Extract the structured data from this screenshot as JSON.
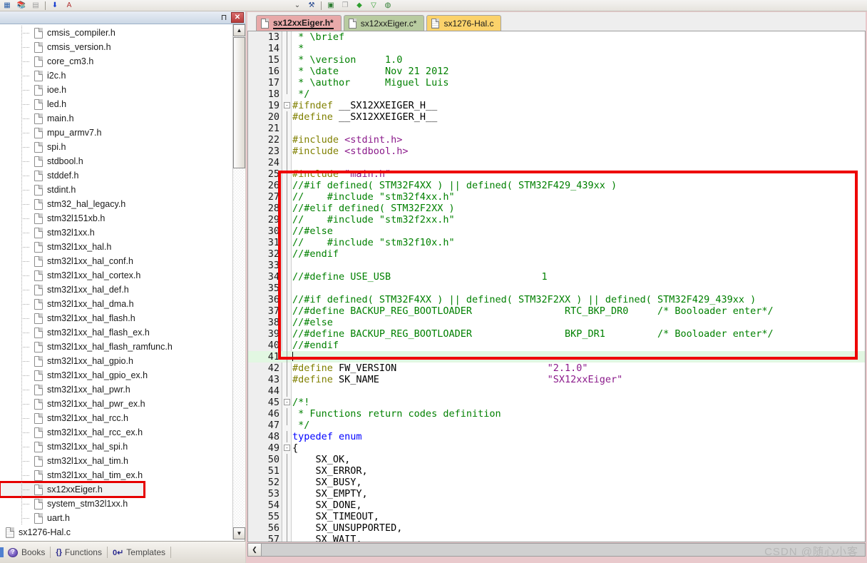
{
  "toolbar": {
    "icons": [
      {
        "name": "grid-icon",
        "glyph": "▦",
        "color": "#2b5fa8"
      },
      {
        "name": "books-stack-icon",
        "glyph": "📚",
        "color": "#2e7d32"
      },
      {
        "name": "remove-book-icon",
        "glyph": "▤",
        "color": "#9e9e9e"
      },
      {
        "name": "sep",
        "glyph": "",
        "color": ""
      },
      {
        "name": "download-arrow-icon",
        "glyph": "⬇",
        "color": "#1a3fd0"
      },
      {
        "name": "font-a-icon",
        "glyph": "A",
        "color": "#b03030"
      },
      {
        "name": "gap",
        "glyph": "",
        "color": ""
      },
      {
        "name": "chevron-down-icon",
        "glyph": "⌄",
        "color": "#444444"
      },
      {
        "name": "binoculars-icon",
        "glyph": "⚒",
        "color": "#1b3f8b"
      },
      {
        "name": "sep",
        "glyph": "",
        "color": ""
      },
      {
        "name": "window-split-icon",
        "glyph": "▣",
        "color": "#2e7d32"
      },
      {
        "name": "window-cascade-icon",
        "glyph": "❐",
        "color": "#9e9e9e"
      },
      {
        "name": "gem-green-icon",
        "glyph": "◆",
        "color": "#2e9e2e"
      },
      {
        "name": "filter-icon",
        "glyph": "▽",
        "color": "#2e9e2e"
      },
      {
        "name": "globe-icon",
        "glyph": "◍",
        "color": "#2e7d32"
      }
    ]
  },
  "project_panel": {
    "pin_label": "⊓",
    "close_label": "✕",
    "tree": [
      {
        "label": "cmsis_compiler.h",
        "type": "header"
      },
      {
        "label": "cmsis_version.h",
        "type": "header"
      },
      {
        "label": "core_cm3.h",
        "type": "header"
      },
      {
        "label": "i2c.h",
        "type": "header"
      },
      {
        "label": "ioe.h",
        "type": "header"
      },
      {
        "label": "led.h",
        "type": "header"
      },
      {
        "label": "main.h",
        "type": "header"
      },
      {
        "label": "mpu_armv7.h",
        "type": "header"
      },
      {
        "label": "spi.h",
        "type": "header"
      },
      {
        "label": "stdbool.h",
        "type": "header"
      },
      {
        "label": "stddef.h",
        "type": "header"
      },
      {
        "label": "stdint.h",
        "type": "header"
      },
      {
        "label": "stm32_hal_legacy.h",
        "type": "header"
      },
      {
        "label": "stm32l151xb.h",
        "type": "header"
      },
      {
        "label": "stm32l1xx.h",
        "type": "header"
      },
      {
        "label": "stm32l1xx_hal.h",
        "type": "header"
      },
      {
        "label": "stm32l1xx_hal_conf.h",
        "type": "header"
      },
      {
        "label": "stm32l1xx_hal_cortex.h",
        "type": "header"
      },
      {
        "label": "stm32l1xx_hal_def.h",
        "type": "header"
      },
      {
        "label": "stm32l1xx_hal_dma.h",
        "type": "header"
      },
      {
        "label": "stm32l1xx_hal_flash.h",
        "type": "header"
      },
      {
        "label": "stm32l1xx_hal_flash_ex.h",
        "type": "header"
      },
      {
        "label": "stm32l1xx_hal_flash_ramfunc.h",
        "type": "header"
      },
      {
        "label": "stm32l1xx_hal_gpio.h",
        "type": "header"
      },
      {
        "label": "stm32l1xx_hal_gpio_ex.h",
        "type": "header"
      },
      {
        "label": "stm32l1xx_hal_pwr.h",
        "type": "header"
      },
      {
        "label": "stm32l1xx_hal_pwr_ex.h",
        "type": "header"
      },
      {
        "label": "stm32l1xx_hal_rcc.h",
        "type": "header"
      },
      {
        "label": "stm32l1xx_hal_rcc_ex.h",
        "type": "header"
      },
      {
        "label": "stm32l1xx_hal_spi.h",
        "type": "header"
      },
      {
        "label": "stm32l1xx_hal_tim.h",
        "type": "header"
      },
      {
        "label": "stm32l1xx_hal_tim_ex.h",
        "type": "header"
      },
      {
        "label": "sx12xxEiger.h",
        "type": "header",
        "selected": true,
        "highlight_box": true
      },
      {
        "label": "system_stm32l1xx.h",
        "type": "header"
      },
      {
        "label": "uart.h",
        "type": "header"
      },
      {
        "label": "sx1276-Hal.c",
        "type": "source",
        "root": true,
        "expander": "+"
      }
    ],
    "scroll_up_glyph": "▲",
    "scroll_down_glyph": "▼"
  },
  "bottom_tabs": [
    {
      "label": "Books",
      "icon": "books-icon"
    },
    {
      "label": "Functions",
      "icon": "braces-icon",
      "glyph": "{}"
    },
    {
      "label": "Templates",
      "icon": "template-icon",
      "glyph": "0↵"
    }
  ],
  "editor_tabs": [
    {
      "label": "sx12xxEiger.h*",
      "active": true,
      "bg": "#e8a9a9",
      "icon": "file-icon"
    },
    {
      "label": "sx12xxEiger.c*",
      "active": false,
      "bg": "#b8cba0",
      "icon": "file-icon"
    },
    {
      "label": "sx1276-Hal.c",
      "active": false,
      "bg": "#fbd26b",
      "icon": "file-c-icon"
    }
  ],
  "editor": {
    "first_line": 13,
    "current_line": 41,
    "hscroll_left_glyph": "❮",
    "lines": [
      {
        "n": 13,
        "fold": "",
        "rule": "full",
        "tokens": [
          {
            "t": " * \\brief",
            "c": "cmt"
          }
        ]
      },
      {
        "n": 14,
        "fold": "",
        "rule": "full",
        "tokens": [
          {
            "t": " *",
            "c": "cmt"
          }
        ]
      },
      {
        "n": 15,
        "fold": "",
        "rule": "full",
        "tokens": [
          {
            "t": " * \\version     1.0",
            "c": "cmt"
          }
        ]
      },
      {
        "n": 16,
        "fold": "",
        "rule": "full",
        "tokens": [
          {
            "t": " * \\date        Nov 21 2012",
            "c": "cmt"
          }
        ]
      },
      {
        "n": 17,
        "fold": "",
        "rule": "full",
        "tokens": [
          {
            "t": " * \\author      Miguel Luis",
            "c": "cmt"
          }
        ]
      },
      {
        "n": 18,
        "fold": "",
        "rule": "end",
        "tokens": [
          {
            "t": " */",
            "c": "cmt"
          }
        ]
      },
      {
        "n": 19,
        "fold": "-",
        "rule": "none",
        "tokens": [
          {
            "t": "#ifndef",
            "c": "pp"
          },
          {
            "t": " __SX12XXEIGER_H__",
            "c": "id"
          }
        ]
      },
      {
        "n": 20,
        "fold": "",
        "rule": "full",
        "tokens": [
          {
            "t": "#define",
            "c": "pp"
          },
          {
            "t": " __SX12XXEIGER_H__",
            "c": "id"
          }
        ]
      },
      {
        "n": 21,
        "fold": "",
        "rule": "full",
        "tokens": []
      },
      {
        "n": 22,
        "fold": "",
        "rule": "full",
        "tokens": [
          {
            "t": "#include",
            "c": "pp"
          },
          {
            "t": " <stdint.h>",
            "c": "str"
          }
        ]
      },
      {
        "n": 23,
        "fold": "",
        "rule": "full",
        "tokens": [
          {
            "t": "#include",
            "c": "pp"
          },
          {
            "t": " <stdbool.h>",
            "c": "str"
          }
        ]
      },
      {
        "n": 24,
        "fold": "",
        "rule": "full",
        "tokens": []
      },
      {
        "n": 25,
        "fold": "",
        "rule": "full",
        "tokens": [
          {
            "t": "#include",
            "c": "pp"
          },
          {
            "t": " \"main.h\"",
            "c": "str"
          }
        ]
      },
      {
        "n": 26,
        "fold": "",
        "rule": "full",
        "tokens": [
          {
            "t": "//#if defined( STM32F4XX ) || defined( STM32F429_439xx )",
            "c": "cmt"
          }
        ]
      },
      {
        "n": 27,
        "fold": "",
        "rule": "full",
        "tokens": [
          {
            "t": "//    #include \"stm32f4xx.h\"",
            "c": "cmt"
          }
        ]
      },
      {
        "n": 28,
        "fold": "",
        "rule": "full",
        "tokens": [
          {
            "t": "//#elif defined( STM32F2XX )",
            "c": "cmt"
          }
        ]
      },
      {
        "n": 29,
        "fold": "",
        "rule": "full",
        "tokens": [
          {
            "t": "//    #include \"stm32f2xx.h\"",
            "c": "cmt"
          }
        ]
      },
      {
        "n": 30,
        "fold": "",
        "rule": "full",
        "tokens": [
          {
            "t": "//#else",
            "c": "cmt"
          }
        ]
      },
      {
        "n": 31,
        "fold": "",
        "rule": "full",
        "tokens": [
          {
            "t": "//    #include \"stm32f10x.h\"",
            "c": "cmt"
          }
        ]
      },
      {
        "n": 32,
        "fold": "",
        "rule": "full",
        "tokens": [
          {
            "t": "//#endif",
            "c": "cmt"
          }
        ]
      },
      {
        "n": 33,
        "fold": "",
        "rule": "full",
        "tokens": []
      },
      {
        "n": 34,
        "fold": "",
        "rule": "full",
        "tokens": [
          {
            "t": "//#define USE_USB                          1",
            "c": "cmt"
          }
        ]
      },
      {
        "n": 35,
        "fold": "",
        "rule": "full",
        "tokens": []
      },
      {
        "n": 36,
        "fold": "",
        "rule": "full",
        "tokens": [
          {
            "t": "//#if defined( STM32F4XX ) || defined( STM32F2XX ) || defined( STM32F429_439xx )",
            "c": "cmt"
          }
        ]
      },
      {
        "n": 37,
        "fold": "",
        "rule": "full",
        "tokens": [
          {
            "t": "//#define BACKUP_REG_BOOTLOADER                RTC_BKP_DR0     /* Booloader enter*/",
            "c": "cmt"
          }
        ]
      },
      {
        "n": 38,
        "fold": "",
        "rule": "full",
        "tokens": [
          {
            "t": "//#else",
            "c": "cmt"
          }
        ]
      },
      {
        "n": 39,
        "fold": "",
        "rule": "full",
        "tokens": [
          {
            "t": "//#define BACKUP_REG_BOOTLOADER                BKP_DR1         /* Booloader enter*/",
            "c": "cmt"
          }
        ]
      },
      {
        "n": 40,
        "fold": "",
        "rule": "full",
        "tokens": [
          {
            "t": "//#endif",
            "c": "cmt"
          }
        ]
      },
      {
        "n": 41,
        "fold": "",
        "rule": "full",
        "current": true,
        "tokens": []
      },
      {
        "n": 42,
        "fold": "",
        "rule": "full",
        "tokens": [
          {
            "t": "#define",
            "c": "pp"
          },
          {
            "t": " FW_VERSION                          ",
            "c": "id"
          },
          {
            "t": "\"2.1.0\"",
            "c": "str"
          }
        ]
      },
      {
        "n": 43,
        "fold": "",
        "rule": "full",
        "tokens": [
          {
            "t": "#define",
            "c": "pp"
          },
          {
            "t": " SK_NAME                             ",
            "c": "id"
          },
          {
            "t": "\"SX12xxEiger\"",
            "c": "str"
          }
        ]
      },
      {
        "n": 44,
        "fold": "",
        "rule": "full",
        "tokens": []
      },
      {
        "n": 45,
        "fold": "-",
        "rule": "none",
        "tokens": [
          {
            "t": "/*!",
            "c": "cmt"
          }
        ]
      },
      {
        "n": 46,
        "fold": "",
        "rule": "full",
        "tokens": [
          {
            "t": " * Functions return codes definition",
            "c": "cmt"
          }
        ]
      },
      {
        "n": 47,
        "fold": "",
        "rule": "end",
        "tokens": [
          {
            "t": " */",
            "c": "cmt"
          }
        ]
      },
      {
        "n": 48,
        "fold": "",
        "rule": "full",
        "tokens": [
          {
            "t": "typedef enum",
            "c": "kw"
          }
        ]
      },
      {
        "n": 49,
        "fold": "-",
        "rule": "none",
        "tokens": [
          {
            "t": "{",
            "c": "id"
          }
        ]
      },
      {
        "n": 50,
        "fold": "",
        "rule": "full",
        "tokens": [
          {
            "t": "    SX_OK,",
            "c": "id"
          }
        ]
      },
      {
        "n": 51,
        "fold": "",
        "rule": "full",
        "tokens": [
          {
            "t": "    SX_ERROR,",
            "c": "id"
          }
        ]
      },
      {
        "n": 52,
        "fold": "",
        "rule": "full",
        "tokens": [
          {
            "t": "    SX_BUSY,",
            "c": "id"
          }
        ]
      },
      {
        "n": 53,
        "fold": "",
        "rule": "full",
        "tokens": [
          {
            "t": "    SX_EMPTY,",
            "c": "id"
          }
        ]
      },
      {
        "n": 54,
        "fold": "",
        "rule": "full",
        "tokens": [
          {
            "t": "    SX_DONE,",
            "c": "id"
          }
        ]
      },
      {
        "n": 55,
        "fold": "",
        "rule": "full",
        "tokens": [
          {
            "t": "    SX_TIMEOUT,",
            "c": "id"
          }
        ]
      },
      {
        "n": 56,
        "fold": "",
        "rule": "full",
        "tokens": [
          {
            "t": "    SX_UNSUPPORTED,",
            "c": "id"
          }
        ]
      },
      {
        "n": 57,
        "fold": "",
        "rule": "full",
        "tokens": [
          {
            "t": "    SX_WAIT,",
            "c": "id"
          }
        ]
      }
    ]
  },
  "watermark": "CSDN @随心小客",
  "colors": {
    "comment": "#008000",
    "preprocessor": "#808000",
    "string": "#8b1a8b",
    "keyword": "#0000ff",
    "annotation_red": "#ee0000",
    "current_line": "#e2f7e2",
    "tab_active": "#e8a9a9",
    "tab_green": "#b8cba0",
    "tab_yellow": "#fbd26b"
  }
}
